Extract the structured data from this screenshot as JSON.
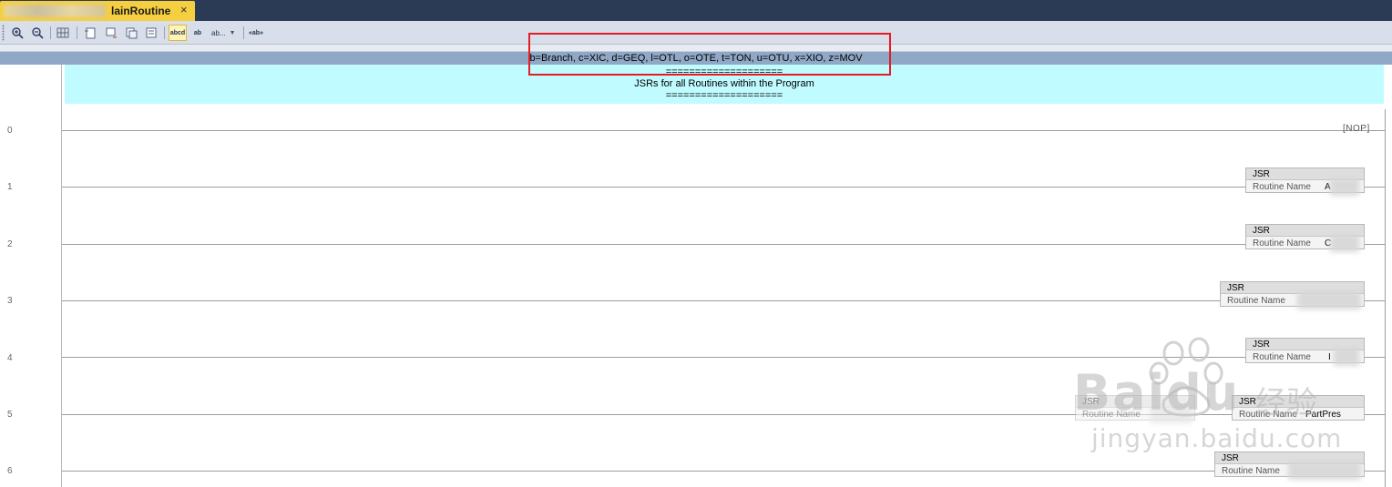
{
  "tab": {
    "title": "lainRoutine",
    "close_glyph": "×"
  },
  "toolbar": {
    "zoom_in_icon": "magnifier-plus-icon",
    "zoom_out_icon": "magnifier-minus-icon",
    "text_mode_label": "abcd",
    "text_mode_alt_label": "ab",
    "dropdown_label": "ab...",
    "tag_label": "«ab»"
  },
  "header": {
    "mnemonics_legend": "b=Branch, c=XIC, d=GEQ, l=OTL, o=OTE, t=TON, u=OTU, x=XIO, z=MOV"
  },
  "comment": {
    "line1": "====================",
    "line2": "JSRs for all Routines within the Program",
    "line3": "===================="
  },
  "rungs": [
    {
      "number": "0",
      "instruction": "NOP"
    },
    {
      "number": "1",
      "instruction": "JSR",
      "param": "Routine Name",
      "value": "A"
    },
    {
      "number": "2",
      "instruction": "JSR",
      "param": "Routine Name",
      "value": "C"
    },
    {
      "number": "3",
      "instruction": "JSR",
      "param": "Routine Name",
      "value": ""
    },
    {
      "number": "4",
      "instruction": "JSR",
      "param": "Routine Name",
      "value": "I"
    },
    {
      "number": "5",
      "instruction": "JSR",
      "param": "Routine Name",
      "value": "PartPres",
      "extra_instruction": "JSR",
      "extra_param": "Routine Name"
    },
    {
      "number": "6",
      "instruction": "JSR",
      "param": "Routine Name",
      "value": ""
    }
  ],
  "watermark": {
    "text": "Baidu",
    "cn_text": "经验",
    "url": "jingyan.baidu.com"
  },
  "colors": {
    "title_bar": "#2b3a55",
    "tab_active": "#f5cf3f",
    "toolbar": "#d8deea",
    "header_band": "#8fa8c6",
    "comment_bg": "#c0fbff",
    "highlight_border": "#e51c23"
  }
}
